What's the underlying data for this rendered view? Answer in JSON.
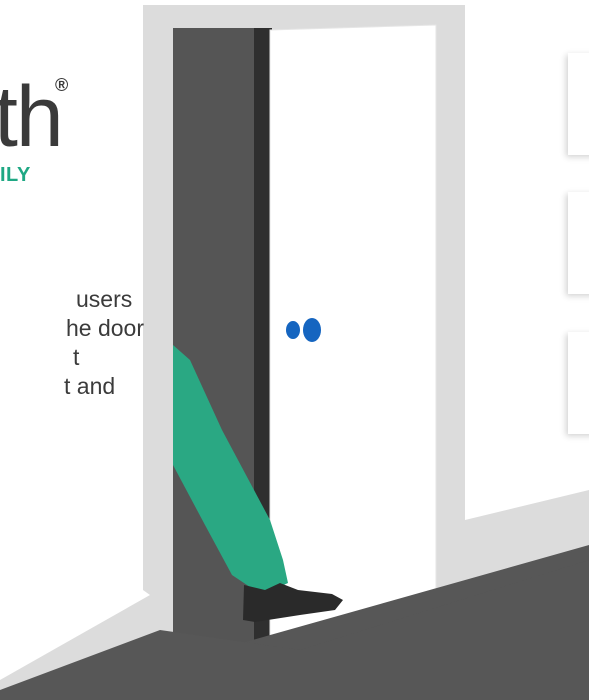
{
  "brand": {
    "logo_letters": "th",
    "registered_mark": "®",
    "tagline_fragment": "ILY",
    "tagline_color": "#1fa884"
  },
  "intro": {
    "lines": [
      "users",
      "he door",
      "t",
      "t and"
    ]
  },
  "illustration": {
    "description_icon": "door-illustration-icon",
    "colors": {
      "wall": "#dcdcdc",
      "doorway": "#555555",
      "door": "#ffffff",
      "knob": "#1565c0",
      "leg": "#2aa883",
      "shoe": "#2a2a2a",
      "floor": "#575757"
    }
  }
}
